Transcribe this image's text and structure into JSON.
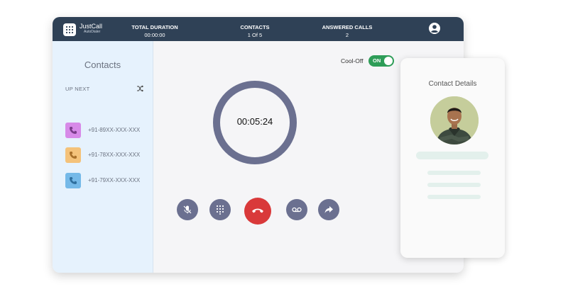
{
  "header": {
    "brand_name": "JustCall",
    "brand_sub": "AutoDialer",
    "stats": [
      {
        "label": "TOTAL DURATION",
        "value": "00:00:00"
      },
      {
        "label": "CONTACTS",
        "value": "1 Of 5"
      },
      {
        "label": "ANSWERED CALLS",
        "value": "2"
      }
    ],
    "user_icon": "user-circle-icon"
  },
  "sidebar": {
    "title": "Contacts",
    "up_next": "UP NEXT",
    "contacts": [
      {
        "number": "+91-89XX-XXX-XXX",
        "color": "#d78ae8"
      },
      {
        "number": "+91-78XX-XXX-XXX",
        "color": "#f4c27a"
      },
      {
        "number": "+91-79XX-XXX-XXX",
        "color": "#75b9e8"
      }
    ]
  },
  "call": {
    "cooloff_label": "Cool-Off",
    "toggle_label": "ON",
    "timer": "00:05:24"
  },
  "details": {
    "title": "Contact Details"
  },
  "colors": {
    "header_bg": "#2f4156",
    "accent_green": "#2e9d58",
    "hangup_red": "#d9393a",
    "control_gray": "#6b7090"
  }
}
